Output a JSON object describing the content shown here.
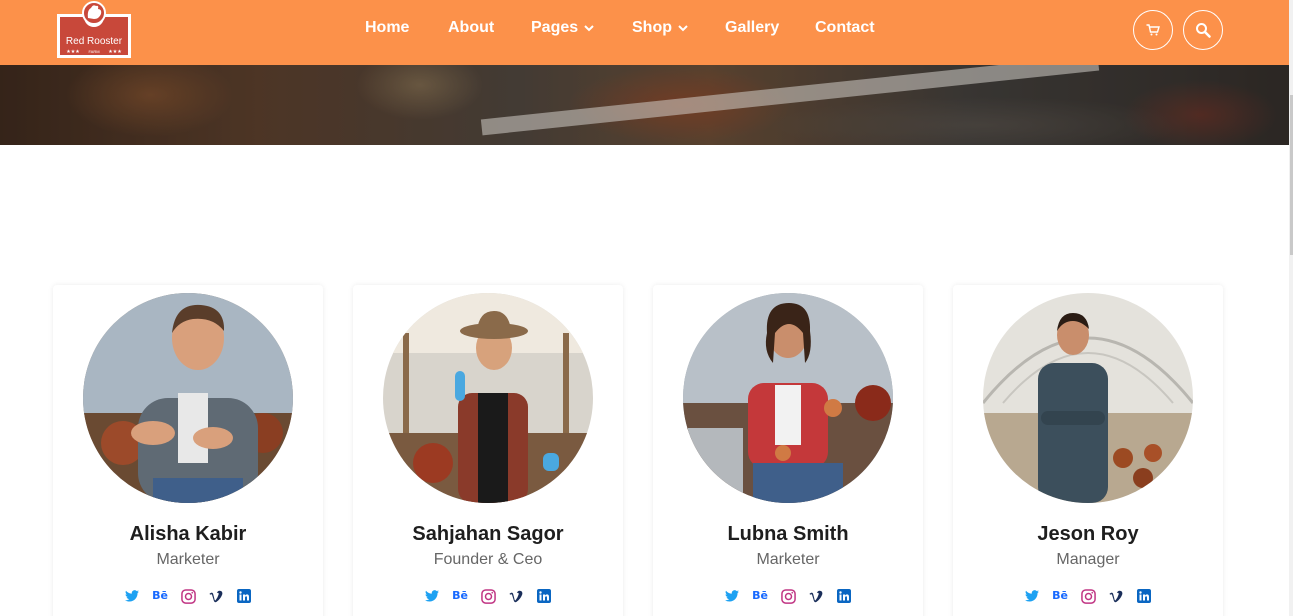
{
  "brand": {
    "name": "Red Rooster",
    "tagline": "FARM",
    "stars": "★★★"
  },
  "nav": {
    "items": [
      {
        "label": "Home"
      },
      {
        "label": "About"
      },
      {
        "label": "Pages",
        "dropdown": true
      },
      {
        "label": "Shop",
        "dropdown": true
      },
      {
        "label": "Gallery"
      },
      {
        "label": "Contact"
      }
    ],
    "cart_icon": "cart-icon",
    "search_icon": "search-icon"
  },
  "colors": {
    "header_bg": "#fc914a",
    "twitter": "#1da1f2",
    "behance": "#1769ff",
    "instagram": "#c13584",
    "vimeo": "#1a2e5a",
    "linkedin": "#0a66c2"
  },
  "team": [
    {
      "name": "Alisha Kabir",
      "role": "Marketer",
      "socials": [
        "twitter",
        "behance",
        "instagram",
        "vimeo",
        "linkedin"
      ]
    },
    {
      "name": "Sahjahan Sagor",
      "role": "Founder & Ceo",
      "socials": [
        "twitter",
        "behance",
        "instagram",
        "vimeo",
        "linkedin"
      ]
    },
    {
      "name": "Lubna Smith",
      "role": "Marketer",
      "socials": [
        "twitter",
        "behance",
        "instagram",
        "vimeo",
        "linkedin"
      ]
    },
    {
      "name": "Jeson Roy",
      "role": "Manager",
      "socials": [
        "twitter",
        "behance",
        "instagram",
        "vimeo",
        "linkedin"
      ]
    }
  ],
  "social_labels": {
    "behance": "Bē"
  }
}
